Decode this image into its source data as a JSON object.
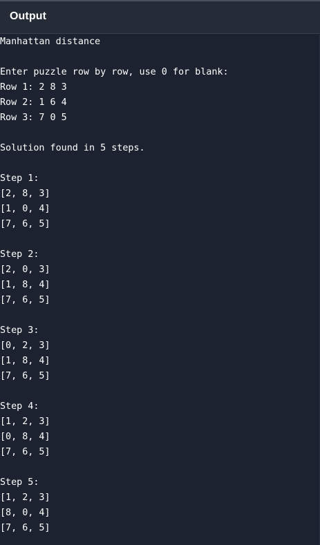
{
  "header": {
    "title": "Output"
  },
  "colors": {
    "background": "#1c2230",
    "header_background": "#252b37",
    "text": "#ffffff"
  },
  "output": {
    "lines": [
      "Manhattan distance",
      "",
      "Enter puzzle row by row, use 0 for blank:",
      "Row 1: 2 8 3",
      "Row 2: 1 6 4",
      "Row 3: 7 0 5",
      "",
      "Solution found in 5 steps.",
      "",
      "Step 1:",
      "[2, 8, 3]",
      "[1, 0, 4]",
      "[7, 6, 5]",
      "",
      "Step 2:",
      "[2, 0, 3]",
      "[1, 8, 4]",
      "[7, 6, 5]",
      "",
      "Step 3:",
      "[0, 2, 3]",
      "[1, 8, 4]",
      "[7, 6, 5]",
      "",
      "Step 4:",
      "[1, 2, 3]",
      "[0, 8, 4]",
      "[7, 6, 5]",
      "",
      "Step 5:",
      "[1, 2, 3]",
      "[8, 0, 4]",
      "[7, 6, 5]"
    ]
  }
}
